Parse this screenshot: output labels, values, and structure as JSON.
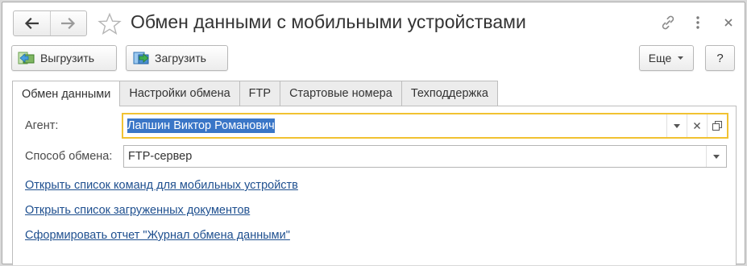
{
  "window": {
    "title": "Обмен данными с мобильными устройствами"
  },
  "toolbar": {
    "upload_label": "Выгрузить",
    "download_label": "Загрузить",
    "more_label": "Еще",
    "help_label": "?"
  },
  "tabs": [
    {
      "label": "Обмен данными",
      "active": true
    },
    {
      "label": "Настройки обмена",
      "active": false
    },
    {
      "label": "FTP",
      "active": false
    },
    {
      "label": "Стартовые номера",
      "active": false
    },
    {
      "label": "Техподдержка",
      "active": false
    }
  ],
  "form": {
    "agent_label": "Агент:",
    "agent_value": "Лапшин Виктор Романович",
    "method_label": "Способ обмена:",
    "method_value": "FTP-сервер"
  },
  "links": [
    "Открыть список команд для мобильных устройств",
    "Открыть список загруженных документов",
    "Сформировать отчет \"Журнал обмена данными\""
  ],
  "colors": {
    "focus_border": "#f1c232",
    "selection": "#3a76c7",
    "link": "#1e4f8f"
  },
  "icons": [
    "back-arrow-icon",
    "forward-arrow-icon",
    "star-icon",
    "link-icon",
    "more-vertical-icon",
    "close-icon",
    "upload-icon",
    "download-icon",
    "dropdown-arrow-icon",
    "clear-icon",
    "open-icon"
  ]
}
